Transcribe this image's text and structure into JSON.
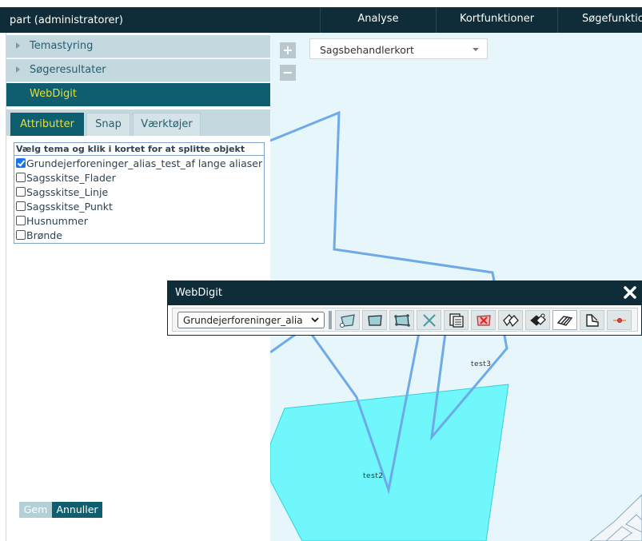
{
  "topbar": {
    "title": "part (administratorer)",
    "nav": [
      "Analyse",
      "Kortfunktioner",
      "Søgefunktion"
    ]
  },
  "sidebar": {
    "sections": [
      {
        "label": "Temastyring",
        "active": false
      },
      {
        "label": "Søgeresultater",
        "active": false
      },
      {
        "label": "WebDigit",
        "active": true
      }
    ],
    "tabs": [
      {
        "label": "Attributter",
        "active": true
      },
      {
        "label": "Snap",
        "active": false
      },
      {
        "label": "Værktøjer",
        "active": false
      }
    ],
    "instruction": "Vælg tema og klik i kortet for at splitte objekt",
    "layers": [
      {
        "label": "Grundejerforeninger_alias_test_af lange aliaser",
        "checked": true
      },
      {
        "label": "Sagsskitse_Flader",
        "checked": false
      },
      {
        "label": "Sagsskitse_Linje",
        "checked": false
      },
      {
        "label": "Sagsskitse_Punkt",
        "checked": false
      },
      {
        "label": "Husnummer",
        "checked": false
      },
      {
        "label": "Brønde",
        "checked": false
      }
    ],
    "save_label": "Gem",
    "cancel_label": "Annuller"
  },
  "map": {
    "zoom_in": "+",
    "zoom_out": "−",
    "basemap_select": "Sagsbehandlerkort",
    "labels": [
      "test3",
      "test2"
    ],
    "colors": {
      "background": "#e6f6fb",
      "polygon_fill": "#6ff7fb",
      "line": "#6ea9e8"
    }
  },
  "webdigit": {
    "title": "WebDigit",
    "layer_select": "Grundejerforeninger_alias_",
    "tools": [
      "draw-polygon-icon",
      "draw-rectangle-icon",
      "edit-vertices-icon",
      "delete-cross-icon",
      "copy-feature-icon",
      "delete-feature-icon",
      "split-feature-icon",
      "merge-feature-icon",
      "split-polygon-icon",
      "reshape-icon",
      "snap-point-icon"
    ],
    "selected_tool": "split-polygon-icon"
  },
  "colors": {
    "topbar": "#0e2d38",
    "accent": "#0f5e70",
    "accent_text": "#e6df3a",
    "panel_bg": "#c3d8df"
  }
}
